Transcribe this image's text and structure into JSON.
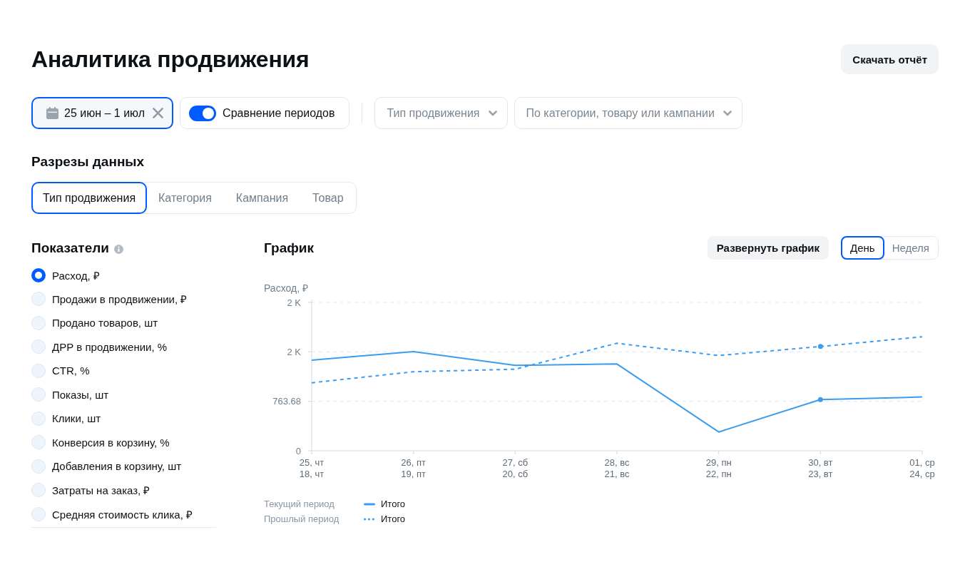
{
  "header": {
    "title": "Аналитика продвижения",
    "download_button": "Скачать отчёт"
  },
  "filters": {
    "date_range": {
      "value": "25 июн – 1 июл",
      "active": true
    },
    "comparison": {
      "label": "Сравнение периодов",
      "on": true
    },
    "dropdowns": [
      {
        "placeholder": "Тип продвижения"
      },
      {
        "placeholder": "По категории, товару или кампании"
      }
    ]
  },
  "slices": {
    "title": "Разрезы данных",
    "tabs": [
      {
        "label": "Тип продвижения",
        "selected": true
      },
      {
        "label": "Категория",
        "selected": false
      },
      {
        "label": "Кампания",
        "selected": false
      },
      {
        "label": "Товар",
        "selected": false
      }
    ]
  },
  "metrics": {
    "title": "Показатели",
    "items": [
      {
        "label": "Расход, ₽",
        "selected": true
      },
      {
        "label": "Продажи в продвижении, ₽",
        "selected": false
      },
      {
        "label": "Продано товаров, шт",
        "selected": false
      },
      {
        "label": "ДРР в продвижении, %",
        "selected": false
      },
      {
        "label": "CTR, %",
        "selected": false
      },
      {
        "label": "Показы, шт",
        "selected": false
      },
      {
        "label": "Клики, шт",
        "selected": false
      },
      {
        "label": "Конверсия в корзину, %",
        "selected": false
      },
      {
        "label": "Добавления в корзину, шт",
        "selected": false
      },
      {
        "label": "Затраты на заказ, ₽",
        "selected": false
      },
      {
        "label": "Средняя стоимость клика, ₽",
        "selected": false
      }
    ]
  },
  "chart_panel": {
    "title": "График",
    "expand_button": "Развернуть график",
    "period_tabs": [
      {
        "label": "День",
        "selected": true
      },
      {
        "label": "Неделя",
        "selected": false
      }
    ],
    "previous_period_dates": [
      "18, чт",
      "19, пт",
      "20, сб",
      "21, вс",
      "22, пн",
      "23, вт",
      "24, ср"
    ],
    "legend_groups": [
      "Текущий период",
      "Прошлый период"
    ],
    "chart_data": {
      "type": "line",
      "ylabel": "Расход, ₽",
      "categories": [
        "25, чт",
        "26, пт",
        "27, сб",
        "28, вс",
        "29, пн",
        "30, вт",
        "01, ср"
      ],
      "ylim": [
        0,
        2291.04
      ],
      "yticks": [
        {
          "value": 0,
          "label": "0"
        },
        {
          "value": 763.68,
          "label": "763.68"
        },
        {
          "value": 1527.36,
          "label": "2 K"
        },
        {
          "value": 2291.04,
          "label": "2 K"
        }
      ],
      "series": [
        {
          "name": "Итого",
          "color": "#3b9cf1",
          "line_style": "solid",
          "values": [
            1400,
            1530,
            1320,
            1340,
            290,
            790,
            830
          ]
        },
        {
          "name": "Итого",
          "color": "#3b9cf1",
          "line_style": "dashed",
          "values": [
            1050,
            1220,
            1260,
            1660,
            1470,
            1610,
            1760
          ]
        }
      ],
      "annotations": [
        {
          "x": "30, вт"
        }
      ]
    }
  }
}
